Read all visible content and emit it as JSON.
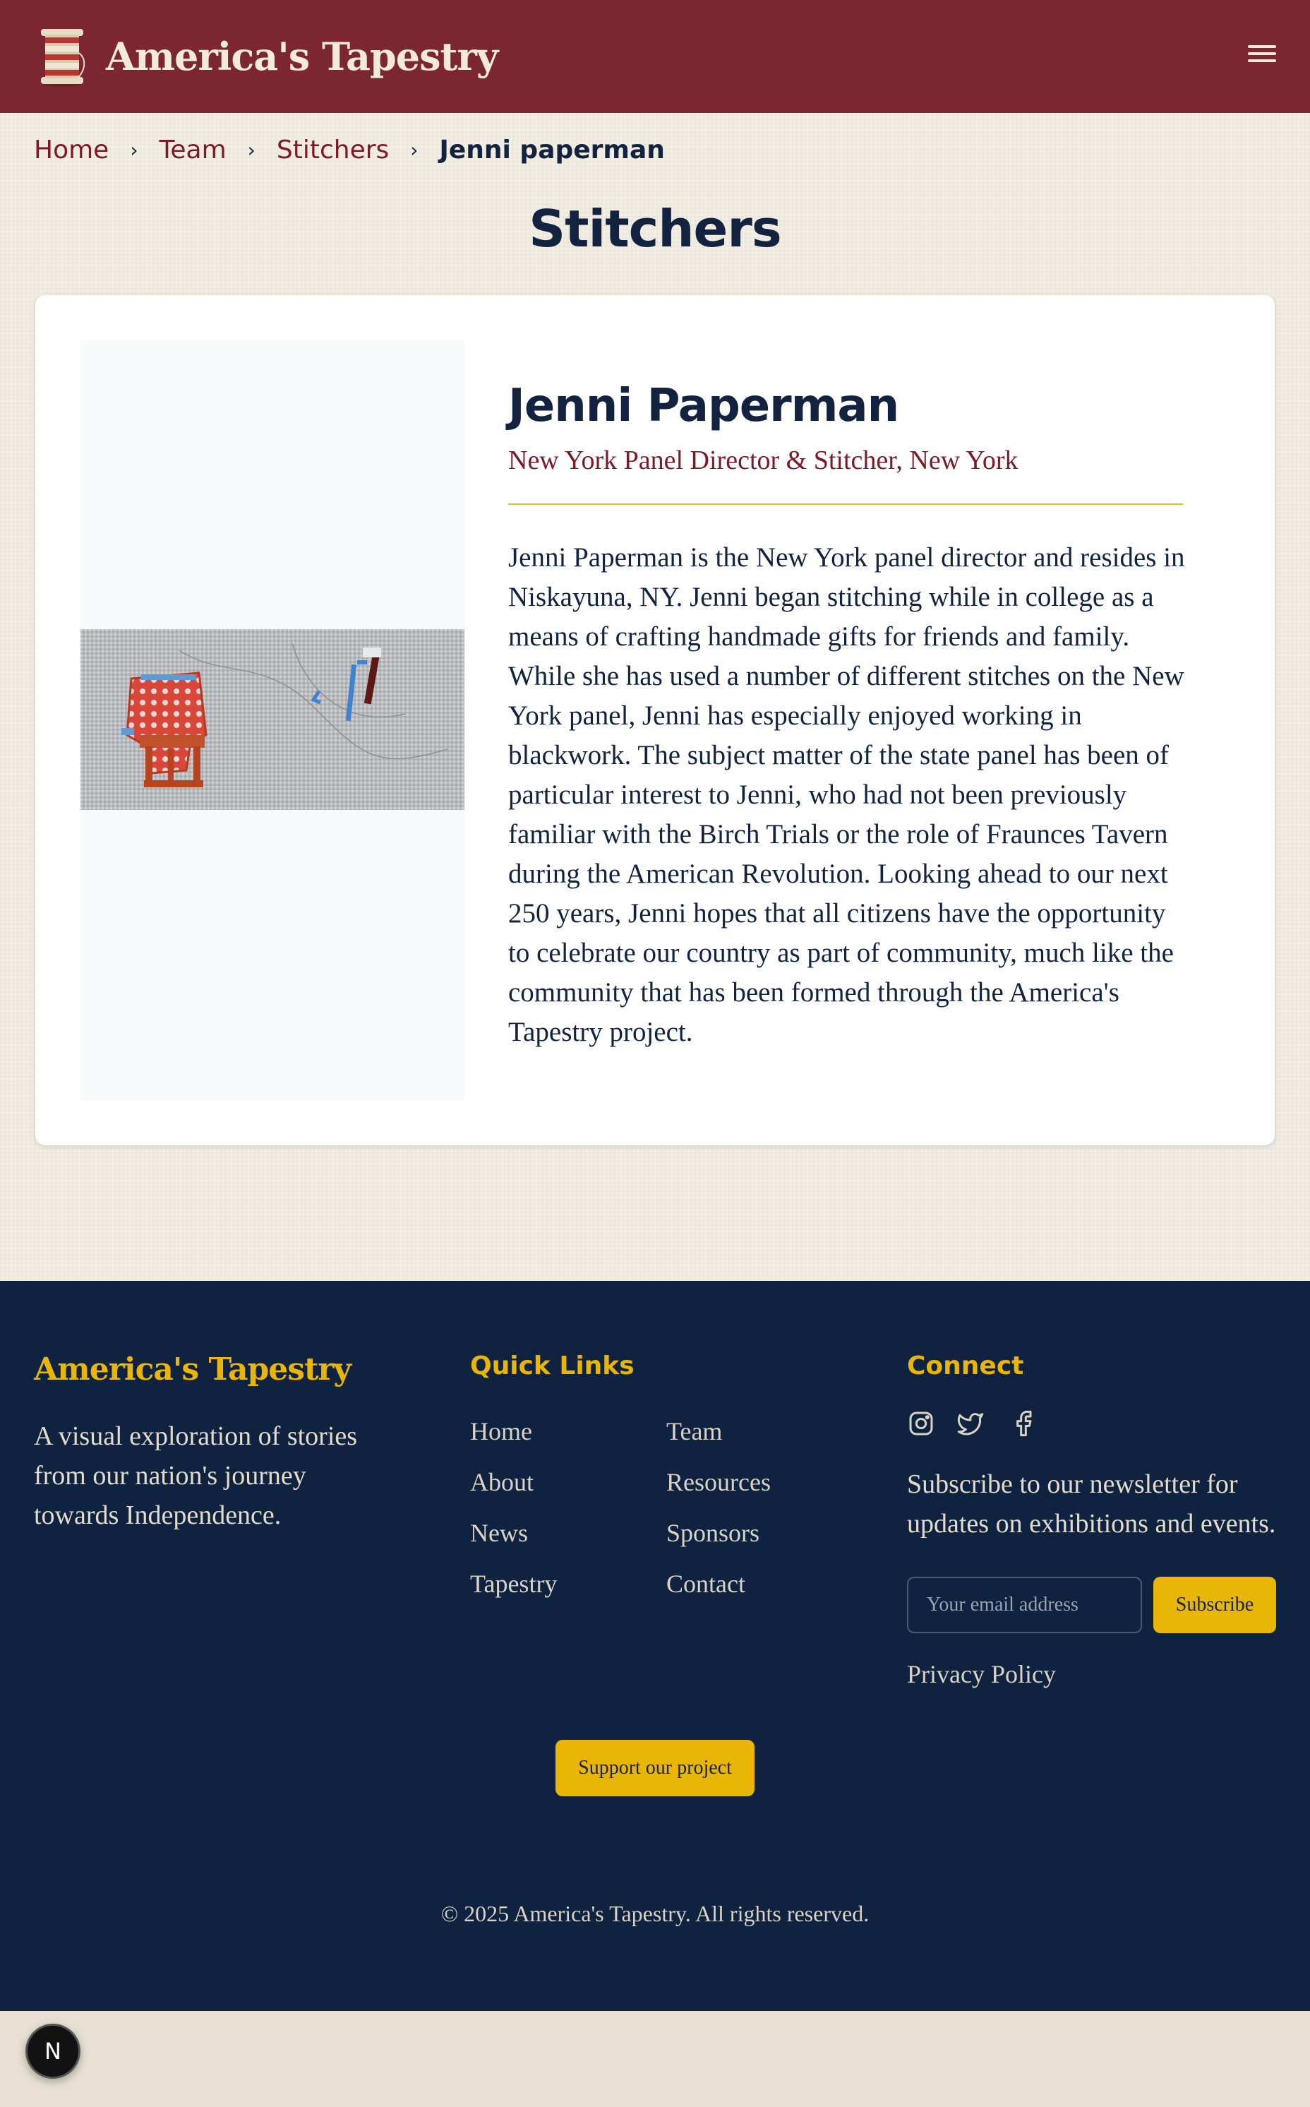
{
  "header": {
    "brand": "America's Tapestry",
    "logo_icon": "thread-spool-icon",
    "menu_icon": "hamburger-menu-icon"
  },
  "breadcrumb": {
    "items": [
      "Home",
      "Team",
      "Stitchers"
    ],
    "current": "Jenni paperman"
  },
  "page": {
    "title": "Stitchers"
  },
  "profile": {
    "name": "Jenni Paperman",
    "role": "New York Panel Director & Stitcher, New York",
    "bio": "Jenni Paperman is the New York panel director and resides in Niskayuna, NY. Jenni began stitching while in college as a means of crafting handmade gifts for friends and family. While she has used a number of different stitches on the New York panel, Jenni has especially enjoyed working in blackwork. The subject matter of the state panel has been of particular interest to Jenni, who had not been previously familiar with the Birch Trials or the role of Fraunces Tavern during the American Revolution. Looking ahead to our next 250 years, Jenni hopes that all citizens have the opportunity to celebrate our country as part of community, much like the community that has been formed through the America's Tapestry project."
  },
  "footer": {
    "brand": "America's Tapestry",
    "tagline": "A visual exploration of stories from our nation's journey towards Independence.",
    "quick_links_heading": "Quick Links",
    "quick_links_col1": [
      "Home",
      "About",
      "News",
      "Tapestry"
    ],
    "quick_links_col2": [
      "Team",
      "Resources",
      "Sponsors",
      "Contact"
    ],
    "connect_heading": "Connect",
    "social_icons": [
      "instagram-icon",
      "twitter-icon",
      "facebook-icon"
    ],
    "newsletter_text": "Subscribe to our newsletter for updates on exhibitions and events.",
    "email_placeholder": "Your email address",
    "subscribe_label": "Subscribe",
    "privacy_label": "Privacy Policy",
    "support_label": "Support our project",
    "copyright": "© 2025 America's Tapestry. All rights reserved."
  },
  "dev_badge": {
    "label": "N"
  },
  "colors": {
    "header_bg": "#7c2632",
    "accent_gold": "#e9b608",
    "navy": "#13233f",
    "footer_bg": "#0f2240",
    "maroon_text": "#7c1a28",
    "page_bg": "#f3eee3"
  }
}
